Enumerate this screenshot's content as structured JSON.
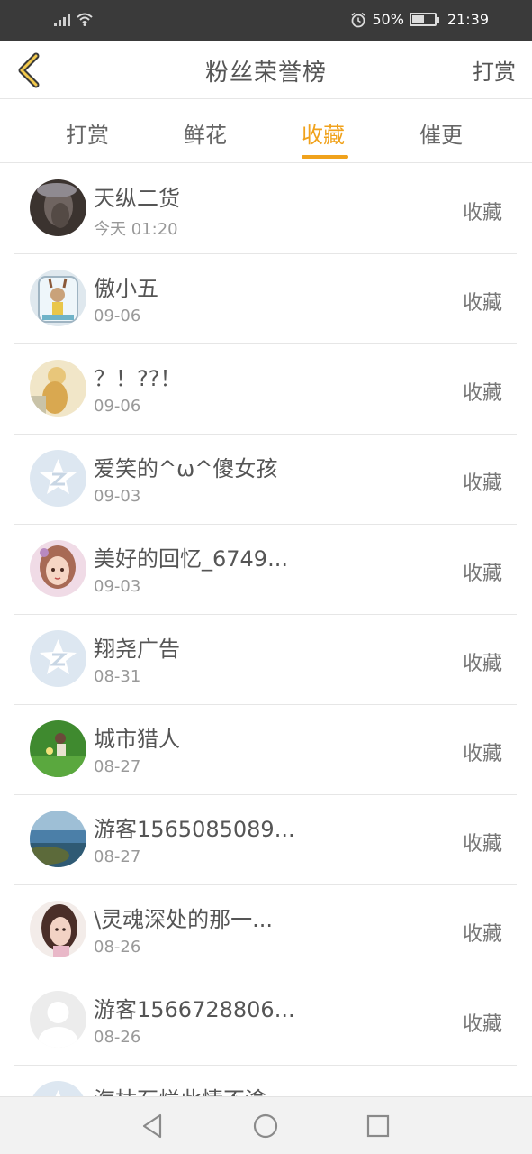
{
  "status_bar": {
    "battery_percent": "50%",
    "time": "21:39",
    "icons": [
      "signal-icon",
      "wifi-icon",
      "alarm-icon",
      "battery-icon"
    ]
  },
  "header": {
    "title": "粉丝荣誉榜",
    "action_label": "打赏",
    "back_icon": "chevron-left-icon"
  },
  "tabs": [
    {
      "label": "打赏",
      "active": false
    },
    {
      "label": "鲜花",
      "active": false
    },
    {
      "label": "收藏",
      "active": true
    },
    {
      "label": "催更",
      "active": false
    }
  ],
  "colors": {
    "accent": "#f0a21c",
    "status_bar": "#3a3a3a",
    "divider": "#e6e6e6"
  },
  "list": [
    {
      "name": "天纵二货",
      "date": "今天 01:20",
      "action": "收藏",
      "avatar": "photo-gray"
    },
    {
      "name": "傲小五",
      "date": "09-06",
      "action": "收藏",
      "avatar": "cartoon-jar"
    },
    {
      "name": "？！??！",
      "date": "09-06",
      "action": "收藏",
      "avatar": "photo-yellow"
    },
    {
      "name": "爱笑的^ω^傻女孩",
      "date": "09-03",
      "action": "收藏",
      "avatar": "qq-default"
    },
    {
      "name": "美好的回忆_6749...",
      "date": "09-03",
      "action": "收藏",
      "avatar": "cartoon-girl"
    },
    {
      "name": "翔尧广告",
      "date": "08-31",
      "action": "收藏",
      "avatar": "qq-default"
    },
    {
      "name": "城市猎人",
      "date": "08-27",
      "action": "收藏",
      "avatar": "photo-green"
    },
    {
      "name": "游客1565085089...",
      "date": "08-27",
      "action": "收藏",
      "avatar": "photo-sea"
    },
    {
      "name": "\\灵魂深处的那一...",
      "date": "08-26",
      "action": "收藏",
      "avatar": "photo-girl"
    },
    {
      "name": "游客1566728806...",
      "date": "08-26",
      "action": "收藏",
      "avatar": "default-person"
    },
    {
      "name": "海枯石烂此情不渝",
      "date": "",
      "action": "",
      "avatar": "qq-default"
    }
  ],
  "nav_bar": {
    "icons": [
      "back-triangle-icon",
      "home-circle-icon",
      "recents-square-icon"
    ]
  }
}
